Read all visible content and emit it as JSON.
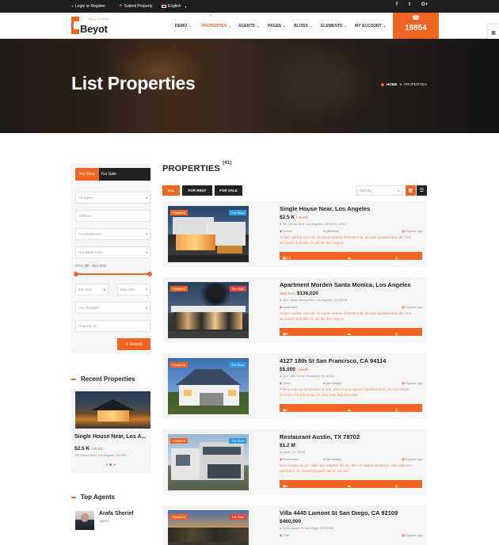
{
  "topbar": {
    "login": "Login or Register",
    "submit": "Submit Property",
    "language": "English",
    "social": [
      "f",
      "t",
      "G+"
    ]
  },
  "header": {
    "logo_text": "Beyot",
    "logo_small": "REAL ESTATE",
    "nav": [
      {
        "label": "DEMO"
      },
      {
        "label": "PROPERTIES"
      },
      {
        "label": "AGENTS"
      },
      {
        "label": "PAGES"
      },
      {
        "label": "BLOGS"
      },
      {
        "label": "ELEMENTS"
      },
      {
        "label": "MY ACCOUNT"
      }
    ],
    "phone": "19854",
    "accent": "#f16522"
  },
  "hero": {
    "title": "List Properties",
    "breadcrumb_home": "HOME",
    "breadcrumb_sep": ">",
    "breadcrumb_current": "PROPERTIES"
  },
  "sidebar": {
    "tab_rent": "For Rent",
    "tab_sale": "For Sale",
    "fields": {
      "types": "All Types",
      "address": "Address",
      "bedrooms": "Any Bedrooms",
      "bathrooms": "Any Bathrooms",
      "price_label": "Price [$0 - $10,000]",
      "min_size": "Min Size",
      "max_size": "Max Size",
      "garages": "Any Garages",
      "property_id": "Property ID"
    },
    "search_label": "Search",
    "recent_heading": "Recent Properties",
    "recent": {
      "title": "Single House Near, Los A...",
      "price": "$2.5 K",
      "per": "/ Month",
      "address": "151 Sunset Blvd, Los Angeles, CA 900..."
    },
    "agents_heading": "Top Agents",
    "agent": {
      "name": "Arafa Sherief",
      "role": "Agent"
    }
  },
  "listing": {
    "heading": "PROPERTIES",
    "count": "(41)",
    "filters": [
      "ALL",
      "FOR RENT",
      "FOR SALE"
    ],
    "sort_placeholder": "Sort By",
    "properties": [
      {
        "badge": "Featured",
        "status": "For Rent",
        "title": "Single House Near, Los Angeles",
        "start": "",
        "price": "$2.5 K",
        "per": "/ Month",
        "address": "151 Sunset Blvd, Los Angeles, CA 90026, USA",
        "type": "House",
        "agent": "glioxsevn",
        "ago": "5 years ago",
        "desc": "Solum veritus eum ea. Ei solum essent delicata mel, ad quis quaerendum sit. Usu accusam iudicabit cu, an his ferri legere",
        "area": "165.5 SqFt",
        "beds": "2",
        "baths": "2"
      },
      {
        "badge": "Featured",
        "status": "For Sale",
        "title": "Apartment Morden Santa Monica, Los Angeles",
        "start": "Start from",
        "price": "$136,020",
        "per": "",
        "address": "1801 Santa Monica Blvd Los Angeles, CA 90038",
        "type": "Apartment",
        "agent": "",
        "ago": "5 years ago",
        "desc": "Solum veritus eum ea. Ei solum essent delicata mel, ad quis quaerendum sit. Usu accusam iudicabit cu, an his ferri legere",
        "area": "225 SqFt",
        "beds": "4",
        "baths": "3"
      },
      {
        "badge": "Featured",
        "status": "For Rent",
        "title": "4127 18th St San Francisco, CA 94114",
        "start": "",
        "price": "$5,000",
        "per": "/ Month",
        "address": "4127 18th St San Francisco, CA 94114",
        "type": "Store",
        "agent": "Aya Magdy",
        "ago": "5 years ago",
        "desc": "Primis ceteros sententiae id eos, mei in meis aperiri reprehendunt, pro ne rebum prompta theophrastus. Ei mea sale repudiandae,",
        "area": "900 SqFt",
        "beds": "4",
        "baths": "3"
      },
      {
        "badge": "Featured",
        "status": "For Rent",
        "title": "Restaurant Austin, TX 78702",
        "start": "",
        "price": "$1.2 M",
        "per": "",
        "address": "Austin, TX 78702",
        "type": "Restaurant",
        "agent": "Aya Magdy",
        "ago": "5 years ago",
        "desc": "Nisl congue eu pri. Nibh wisi adipisci his ea. Mel ut magna minimum. Usu allienum patrioque an, iuvaret feugait has in, ad sed",
        "area": "220 SqFt",
        "beds": "4",
        "baths": "3"
      },
      {
        "badge": "Featured",
        "status": "For Sale",
        "title": "Villa 4445 Lamont St San Diego, CA 92109",
        "start": "",
        "price": "$460,000",
        "per": "",
        "address": "4445 Lamont St San Diego, CA 92109",
        "type": "Villa",
        "agent": "",
        "ago": "5 years ago",
        "desc": "",
        "area": "",
        "beds": "",
        "baths": ""
      }
    ]
  }
}
